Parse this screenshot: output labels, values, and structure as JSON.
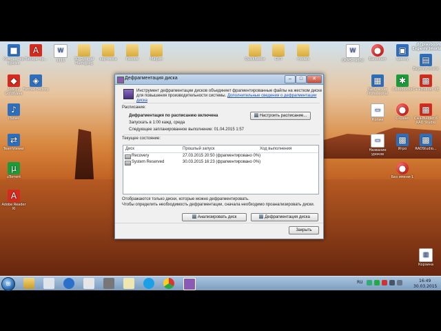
{
  "desktop": {
    "icons": [
      {
        "label": "Компьютер Время",
        "glyph": "■",
        "cls": "app"
      },
      {
        "label": "Лаборатор...",
        "glyph": "A",
        "cls": "pdf"
      },
      {
        "label": "1111",
        "glyph": "W",
        "cls": "doc"
      },
      {
        "label": "3D Optimal HamsJpeg",
        "glyph": "",
        "cls": "folder"
      },
      {
        "label": "картинка",
        "glyph": "",
        "cls": "folder"
      },
      {
        "label": "Разное",
        "glyph": "",
        "cls": "folder"
      },
      {
        "label": "Мафия",
        "glyph": "",
        "cls": "folder"
      },
      {
        "label": "QuickBooks",
        "glyph": "",
        "cls": "folder"
      },
      {
        "label": "СРП",
        "glyph": "",
        "cls": "folder"
      },
      {
        "label": "models",
        "glyph": "",
        "cls": "folder"
      },
      {
        "label": "OKMS-табл2",
        "glyph": "W",
        "cls": "doc"
      },
      {
        "label": "Bandicam",
        "glyph": "●",
        "cls": "redball"
      },
      {
        "label": "Speccy",
        "glyph": "▣",
        "cls": "app"
      },
      {
        "label": "Evgeniy Jmoriz",
        "glyph": "▤",
        "cls": "app"
      },
      {
        "label": "SMPTV GoldWave",
        "glyph": "◆",
        "cls": "pdf"
      },
      {
        "label": "Format Factory",
        "glyph": "◈",
        "cls": "app"
      },
      {
        "label": "NetCracker Professional",
        "glyph": "▦",
        "cls": "app"
      },
      {
        "label": "CodeBlocks",
        "glyph": "✱",
        "cls": "green"
      },
      {
        "label": "C++Builder XE",
        "glyph": "▩",
        "cls": "pdf"
      },
      {
        "label": "iTunes",
        "glyph": "♪",
        "cls": "app"
      },
      {
        "label": "Копия",
        "glyph": "▭",
        "cls": "doc"
      },
      {
        "label": "C-Clean",
        "glyph": "●",
        "cls": "redball"
      },
      {
        "label": "C++Builder 6 RAD Studio",
        "glyph": "▩",
        "cls": "pdf"
      },
      {
        "label": "TeamViewer",
        "glyph": "⇄",
        "cls": "app"
      },
      {
        "label": "Название уроков",
        "glyph": "▭",
        "cls": "doc"
      },
      {
        "label": "Игро",
        "glyph": "▩",
        "cls": "app"
      },
      {
        "label": "RADStudio...",
        "glyph": "▩",
        "cls": "app"
      },
      {
        "label": "uTorrent",
        "glyph": "µ",
        "cls": "green"
      },
      {
        "label": "Без имени-1",
        "glyph": "●",
        "cls": "redball"
      },
      {
        "label": "Adobe Reader XI",
        "glyph": "A",
        "cls": "pdf"
      },
      {
        "label": "Корзина",
        "glyph": "▥",
        "cls": "doc"
      }
    ]
  },
  "dialog": {
    "title": "Дефрагментация диска",
    "minimize": "–",
    "maximize": "□",
    "close": "✕",
    "intro_text": "Инструмент дефрагментации дисков объединяет фрагментированные файлы на жестком диске для повышения производительности системы. ",
    "intro_link": "Дополнительные сведения о дефрагментации диска",
    "schedule_heading": "Расписание:",
    "schedule_status": "Дефрагментация по расписанию включена",
    "schedule_run": "Запускать в 1:00 кажд. среда",
    "schedule_next": "Следующее запланированное выполнение: 01.04.2015 1:57",
    "configure_button": "Настроить расписание...",
    "current_state": "Текущее состояние:",
    "columns": [
      "Диск",
      "Прошлый запуск",
      "Ход выполнения"
    ],
    "disks": [
      {
        "name": "Recovery",
        "last_run": "27.03.2015 20:50 (фрагментировано 0%)",
        "progress": ""
      },
      {
        "name": "System Reserved",
        "last_run": "30.03.2015 16:23 (фрагментировано 0%)",
        "progress": ""
      }
    ],
    "note_line1": "Отображаются только диски, которые можно дефрагментировать.",
    "note_line2": "Чтобы определить необходимость дефрагментации, сначала необходимо проанализировать диски.",
    "analyze_button": "Анализировать диск",
    "defrag_button": "Дефрагментация диска",
    "close_button": "Закрыть"
  },
  "taskbar": {
    "start_glyph": "⊞",
    "lang": "RU",
    "time": "16:49",
    "date": "30.03.2015"
  },
  "watermark": "dr playboom Evgeniy Jmoriz"
}
